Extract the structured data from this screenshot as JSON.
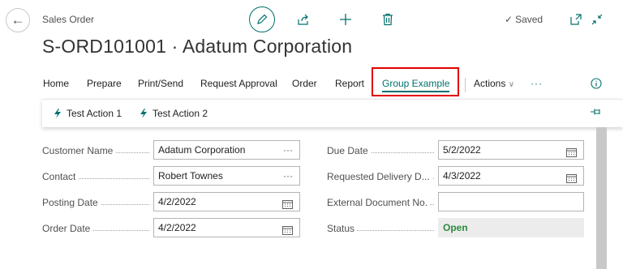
{
  "header": {
    "breadcrumb": "Sales Order",
    "saved_label": "Saved",
    "title": "S-ORD101001 · Adatum Corporation"
  },
  "actions": [
    {
      "label": "Home"
    },
    {
      "label": "Prepare"
    },
    {
      "label": "Print/Send"
    },
    {
      "label": "Request Approval"
    },
    {
      "label": "Order"
    },
    {
      "label": "Report"
    },
    {
      "label": "Group Example",
      "selected": true
    },
    {
      "label": "Actions"
    },
    {
      "label": "···"
    }
  ],
  "sub_actions": [
    {
      "label": "Test Action 1"
    },
    {
      "label": "Test Action 2"
    }
  ],
  "form": {
    "left": [
      {
        "label": "Customer Name",
        "value": "Adatum Corporation",
        "suffix": "···"
      },
      {
        "label": "Contact",
        "value": "Robert Townes",
        "suffix": "···"
      },
      {
        "label": "Posting Date",
        "value": "4/2/2022"
      },
      {
        "label": "Order Date",
        "value": "4/2/2022"
      }
    ],
    "right": [
      {
        "label": "Due Date",
        "value": "5/2/2022"
      },
      {
        "label": "Requested Delivery D...",
        "value": "4/3/2022"
      },
      {
        "label": "External Document No.",
        "value": ""
      },
      {
        "label": "Status",
        "value": "Open"
      }
    ]
  },
  "colors": {
    "accent": "#00706b",
    "highlight": "#e00000",
    "status": "#2b8a3e"
  }
}
